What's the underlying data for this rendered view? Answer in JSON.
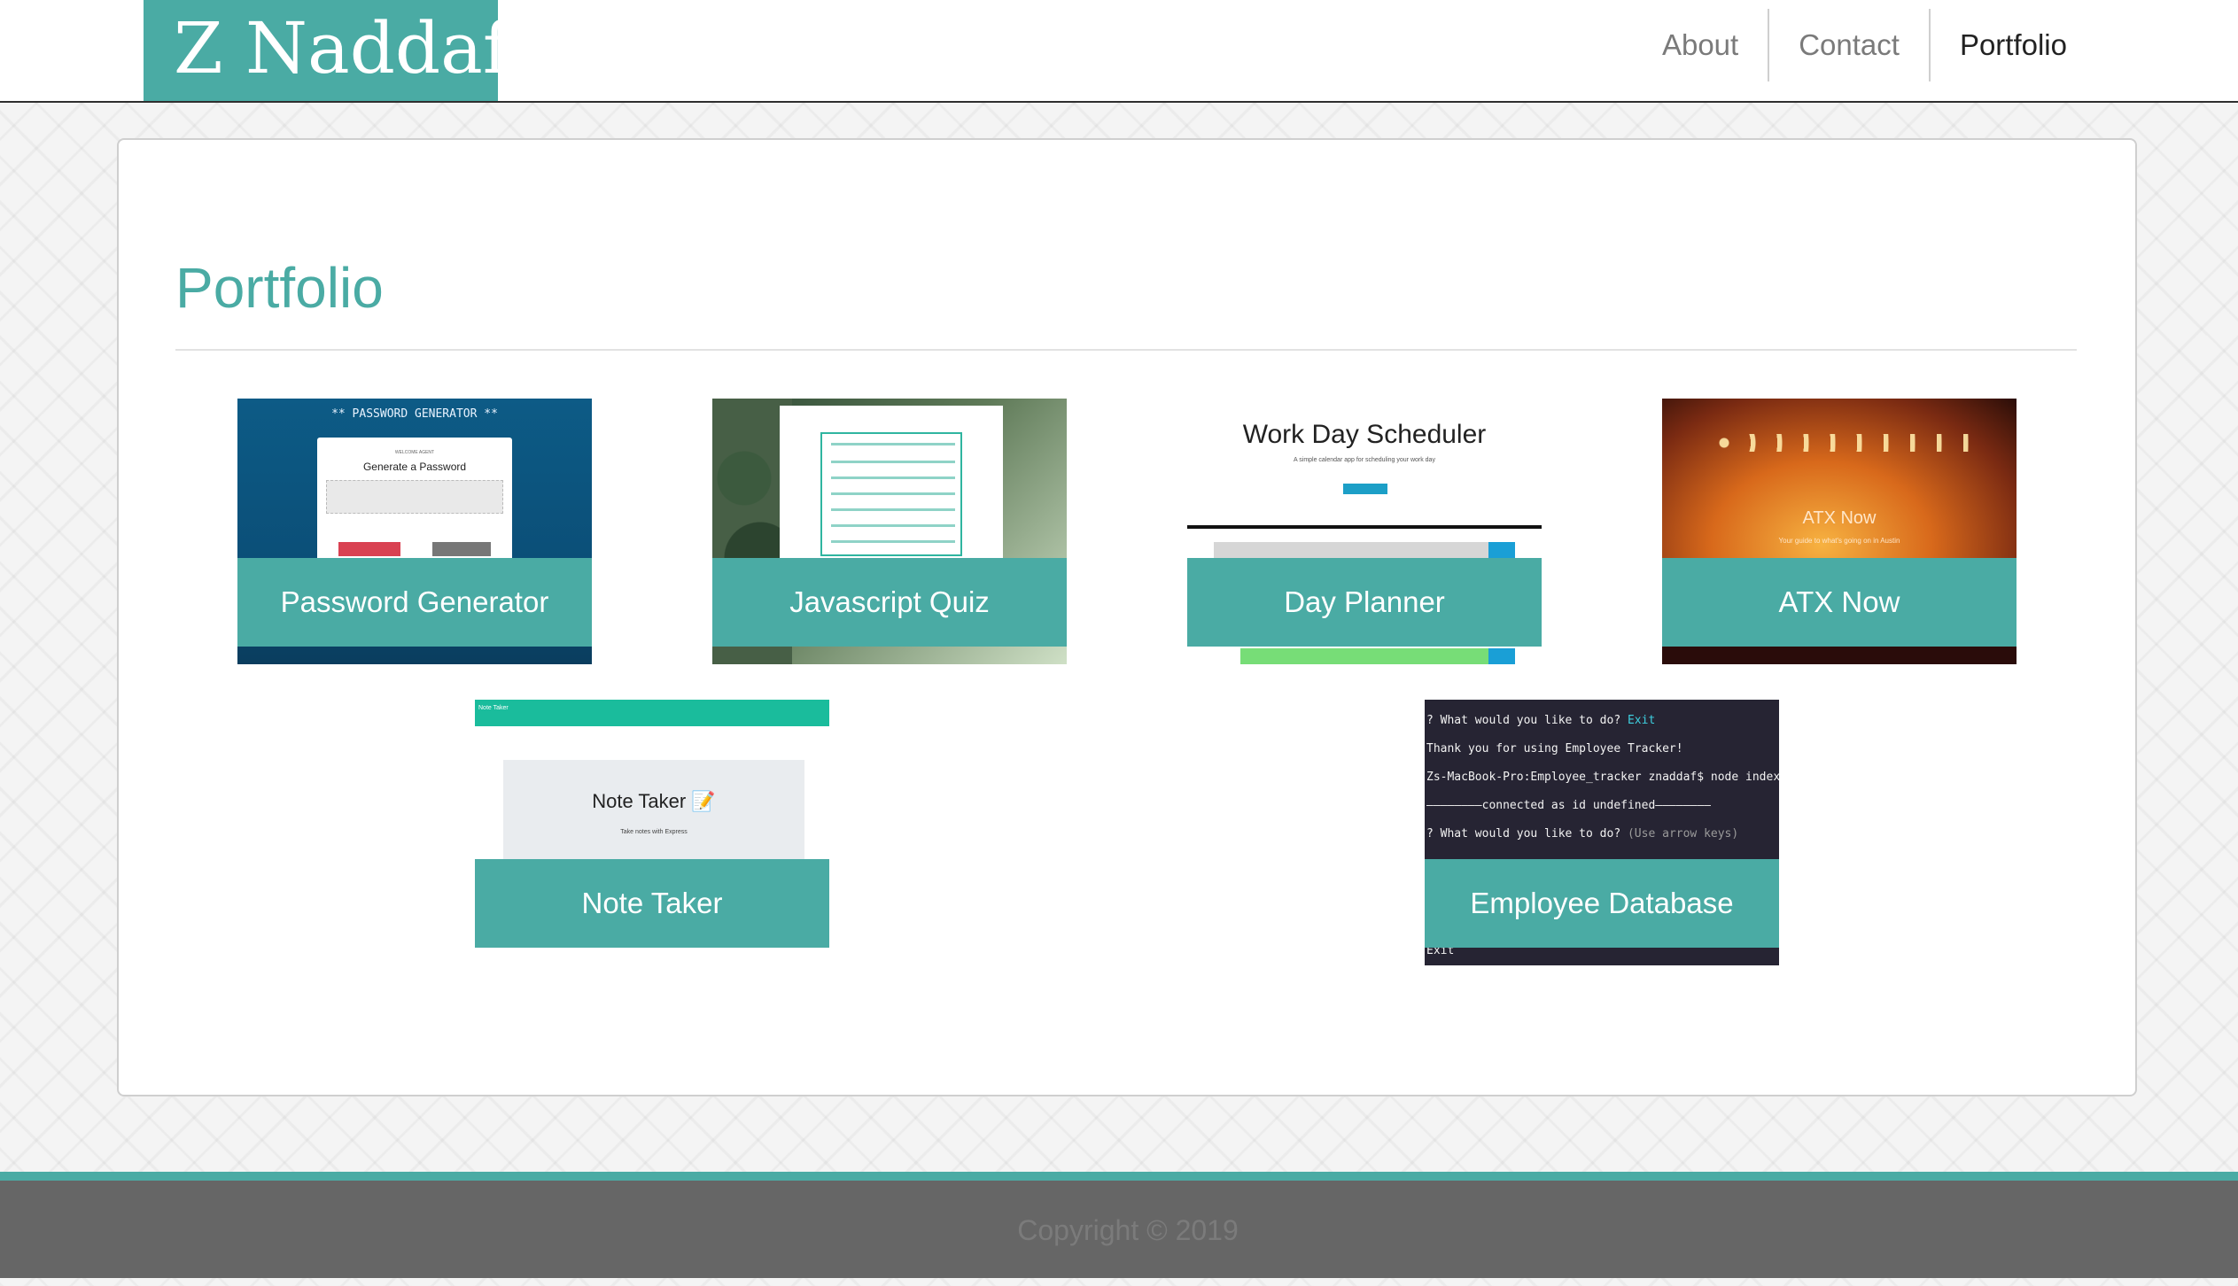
{
  "header": {
    "brand": "Z Naddaf",
    "nav": [
      {
        "label": "About"
      },
      {
        "label": "Contact"
      },
      {
        "label": "Portfolio"
      }
    ]
  },
  "main": {
    "title": "Portfolio",
    "projects": [
      {
        "label": "Password Generator",
        "thumb": {
          "heading": "** PASSWORD GENERATOR **",
          "small": "WELCOME AGENT",
          "title": "Generate a Password"
        }
      },
      {
        "label": "Javascript Quiz",
        "thumb": {}
      },
      {
        "label": "Day Planner",
        "thumb": {
          "title": "Work Day Scheduler",
          "subtitle": "A simple calendar app for scheduling your work day"
        }
      },
      {
        "label": "ATX Now",
        "thumb": {
          "title": "ATX Now",
          "subtitle": "Your guide to what's going on in Austin"
        }
      },
      {
        "label": "Note Taker",
        "thumb": {
          "navbar": "Note Taker",
          "title": "Note Taker 📝",
          "subtitle": "Take notes with Express"
        }
      },
      {
        "label": "Employee Database",
        "thumb": {
          "lines": [
            {
              "text": "? What would you like to do? ",
              "accent": "Exit"
            },
            {
              "text": "Thank you for using Employee Tracker!"
            },
            {
              "text": "Zs-MacBook-Pro:Employee_tracker znaddaf$ node index.js"
            },
            {
              "text": "————————connected as id undefined————————"
            },
            {
              "text": "? What would you like to do? ",
              "hint": "(Use arrow keys)"
            },
            {
              "text": "Exit"
            }
          ]
        }
      }
    ]
  },
  "footer": {
    "copyright": "Copyright © 2019"
  },
  "colors": {
    "accent": "#4aaba4",
    "footer_bg": "#666666",
    "footer_text": "#7b7b7b"
  }
}
